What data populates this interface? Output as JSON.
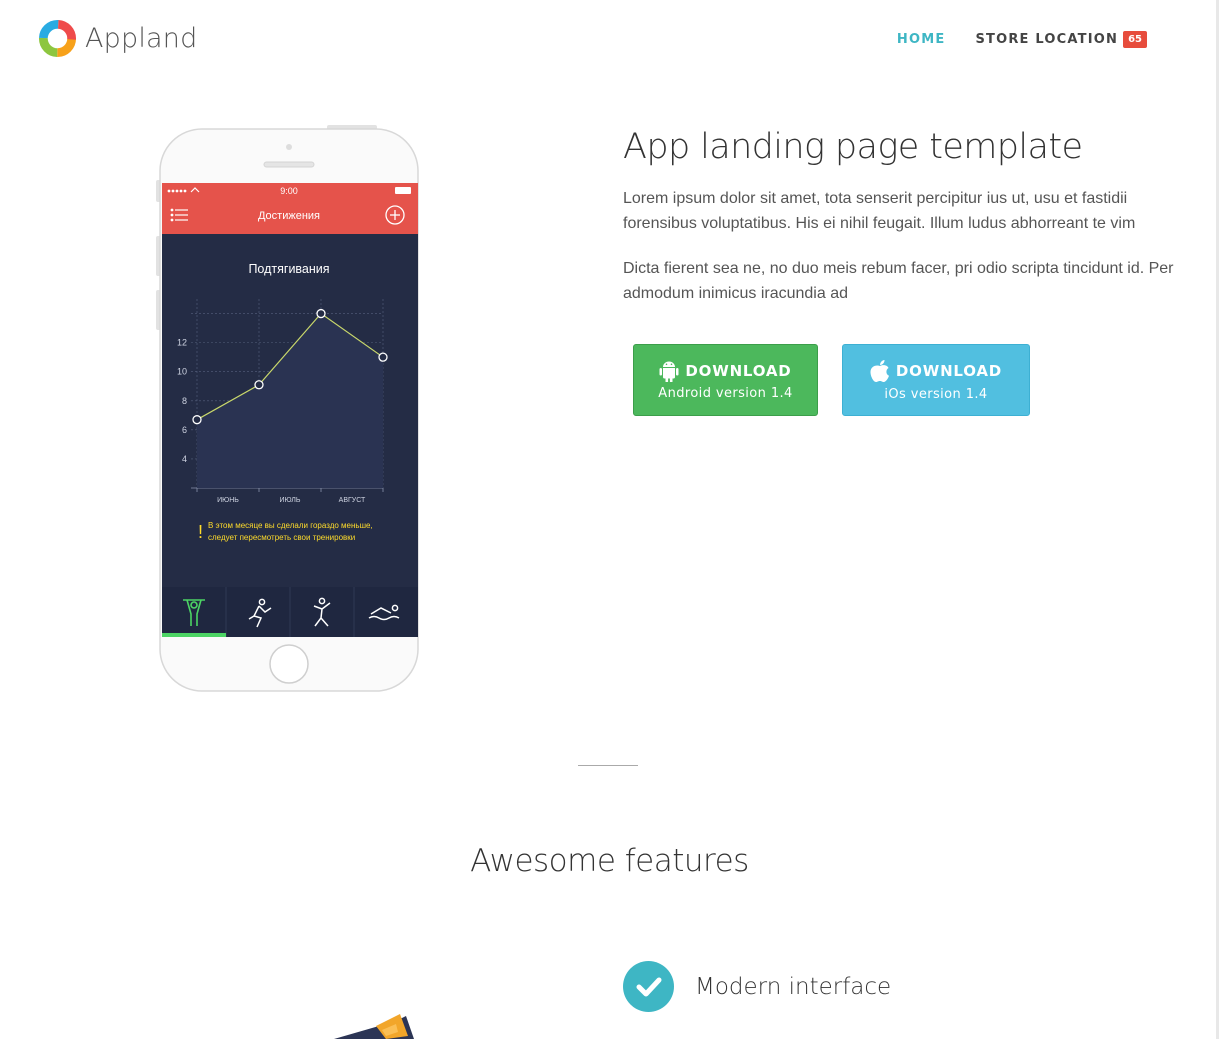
{
  "brand": {
    "name": "Appland"
  },
  "nav": {
    "items": [
      {
        "label": "HOME",
        "active": true
      },
      {
        "label": "STORE LOCATION",
        "badge": "65"
      }
    ]
  },
  "phone": {
    "status": {
      "time": "9:00"
    },
    "app_title": "Достижения",
    "chart_title": "Подтягивания",
    "warning": [
      "В этом месяце вы сделали гораздо меньше,",
      "следует пересмотреть свои тренировки"
    ],
    "tabs": [
      "pullup-icon",
      "run-icon",
      "jump-icon",
      "swim-icon"
    ]
  },
  "chart_data": {
    "type": "line",
    "title": "Подтягивания",
    "categories": [
      "ИЮНЬ",
      "ИЮЛЬ",
      "АВГУСТ"
    ],
    "x": [
      0,
      1,
      2,
      3
    ],
    "values": [
      6.7,
      9.1,
      14.0,
      11.0
    ],
    "yticks": [
      4,
      6,
      8,
      10,
      12
    ],
    "ylim": [
      2,
      15
    ],
    "grid": true
  },
  "hero": {
    "title": "App landing page template",
    "paragraphs": [
      "Lorem ipsum dolor sit amet, tota senserit percipitur ius ut, usu et fastidii forensibus voluptatibus. His ei nihil feugait. Illum ludus abhorreant te vim",
      "Dicta fierent sea ne, no duo meis rebum facer, pri odio scripta tincidunt id. Per admodum inimicus iracundia ad"
    ]
  },
  "downloads": {
    "android": {
      "label": "DOWNLOAD",
      "sub": "Android version 1.4",
      "color": "#4cb85c"
    },
    "ios": {
      "label": "DOWNLOAD",
      "sub": "iOs version 1.4",
      "color": "#51bfe0"
    }
  },
  "features": {
    "title": "Awesome features",
    "items": [
      {
        "title": "Modern interface",
        "icon": "check-icon"
      }
    ]
  },
  "colors": {
    "accent": "#3eb6c4",
    "badge": "#e74c3c",
    "app_header": "#e5534b",
    "app_bg": "#242c45"
  }
}
